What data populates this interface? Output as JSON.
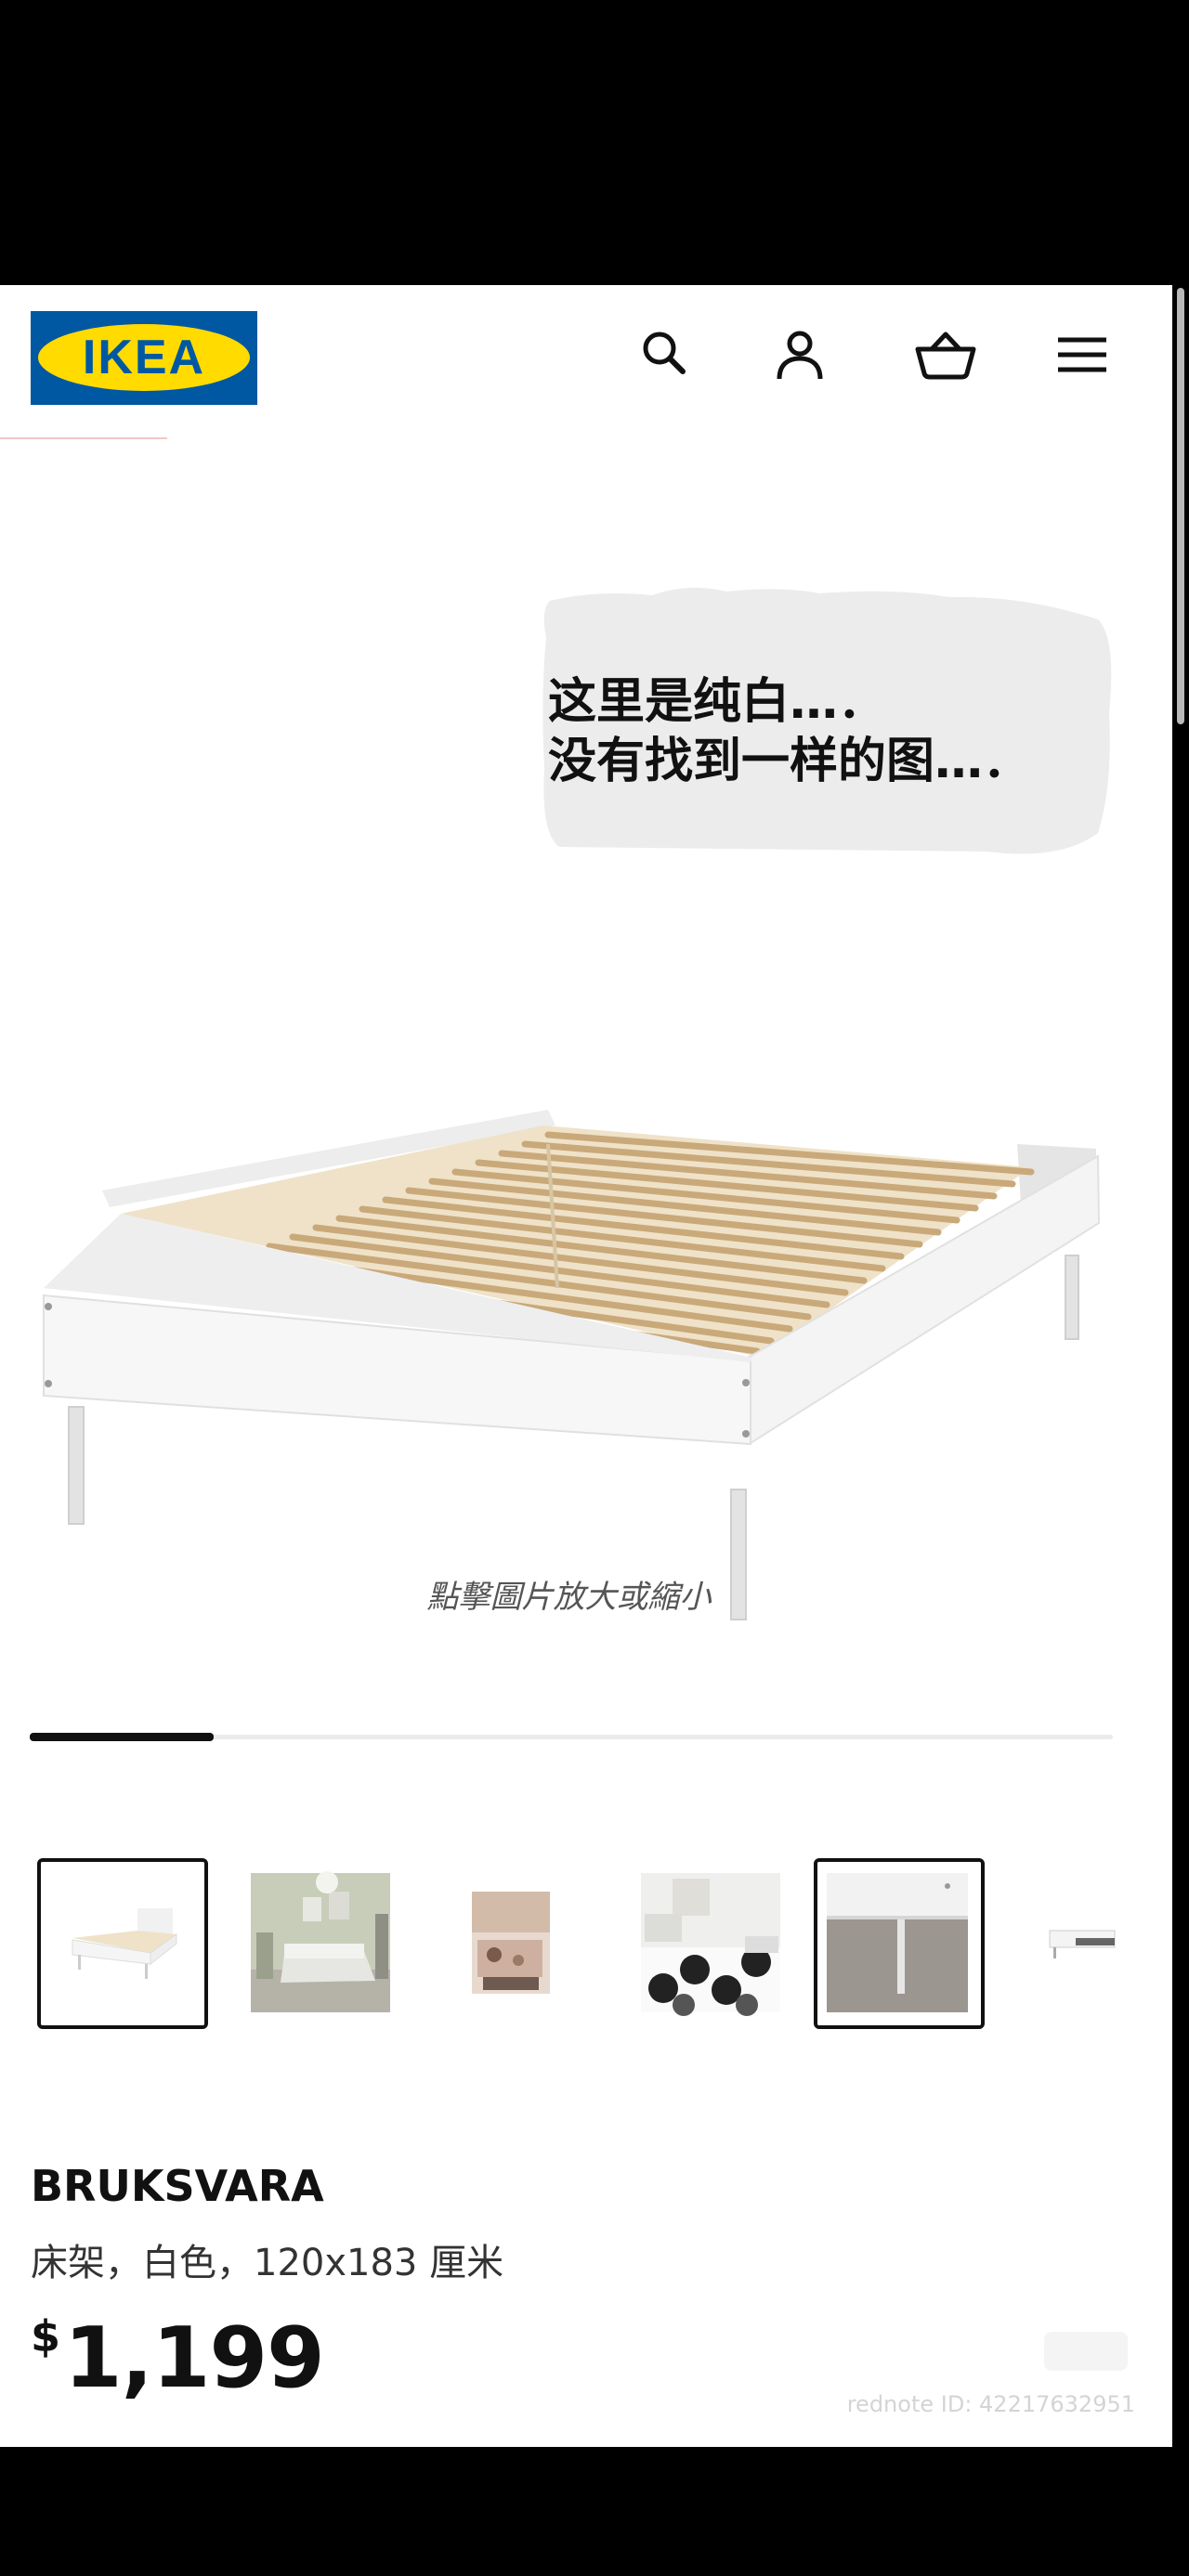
{
  "header": {
    "logo_text": "IKEA",
    "icons": [
      "search-icon",
      "user-icon",
      "basket-icon",
      "menu-icon"
    ]
  },
  "gallery": {
    "overlay_note": [
      "这里是纯白…．",
      "没有找到一样的图…．"
    ],
    "zoom_hint": "點擊圖片放大或縮小",
    "progress_fraction": 0.17,
    "thumbnails": [
      {
        "id": "thumb-bed-front",
        "selected": true
      },
      {
        "id": "thumb-bedroom-scene",
        "selected": false
      },
      {
        "id": "thumb-kids-room",
        "selected": false
      },
      {
        "id": "thumb-bedding-pattern",
        "selected": false
      },
      {
        "id": "thumb-leg-detail",
        "selected": true
      },
      {
        "id": "thumb-bed-detail",
        "selected": false
      }
    ]
  },
  "product": {
    "name": "BRUKSVARA",
    "description": "床架，白色，120x183 厘米",
    "currency": "$",
    "price": "1,199"
  },
  "watermark": "rednote ID: 42217632951",
  "colors": {
    "ikea_blue": "#0058a3",
    "ikea_yellow": "#ffdb00"
  }
}
